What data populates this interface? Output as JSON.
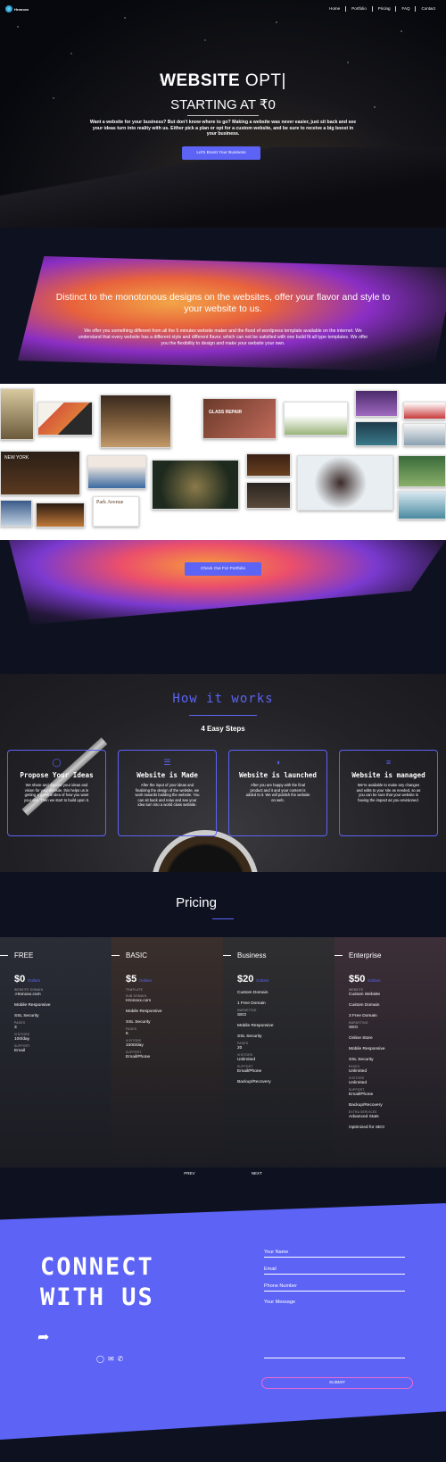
{
  "nav": {
    "logo_text": "Hronoxx",
    "items": [
      "Home",
      "Portfolio",
      "Pricing",
      "FAQ",
      "Contact"
    ]
  },
  "hero": {
    "title_bold": "WEBSITE",
    "title_light": "OPT|",
    "subtitle": "STARTING AT ₹0",
    "paragraph": "Want a website for your business? But don't know where to go? Making a website was never easier, just sit back and see your ideas turn into reality with us. Either pick a plan or opt for a custom website, and be sure to receive a big boost in your business.",
    "button": "Let's Boost Your Business"
  },
  "design": {
    "title": "Distinct to the monotonous designs on the websites, offer your flavor and style to your website to us.",
    "paragraph": "We offer you something different from all the 5 minutes website maker and the flood of wordpress template available on the internet. We understand that every website has a different style and different flavor, which can not be satisfied with one build fit all type templates. We offer you the flexibility to design and make your website your own.",
    "button": "Check Out For Portfolio",
    "thumb_texts": [
      "GLASS REPAIR",
      "NEW YORK",
      "Park Avenue",
      "Photo Gallery",
      "Make Yourself Beautiful"
    ]
  },
  "how": {
    "title": "How it works",
    "subtitle": "4 Easy Steps",
    "steps": [
      {
        "icon": "lightbulb-icon",
        "title": "Propose Your Ideas",
        "text": "We share and discuss your ideas and vision for your website, this helps us in getting a general idea of how you want your site. Then we start to build upon it."
      },
      {
        "icon": "layers-icon",
        "title": "Website is Made",
        "text": "After the input of your ideas and finalizing the design of the website, we work towards building the website. You can sit back and relax and see your idea turn into a world class website."
      },
      {
        "icon": "globe-icon",
        "title": "Website is launched",
        "text": "After you are happy with the final product and it and your content is added to it. We will publish the website on web."
      },
      {
        "icon": "list-check-icon",
        "title": "Website is managed",
        "text": "We're available to make any changes and edits to your site as needed, so as you can be sure that your website is having the impact as you envisioned."
      }
    ]
  },
  "pricing": {
    "title": "Pricing",
    "plans": [
      {
        "name": "FREE",
        "price": "$0",
        "period": "Dollars",
        "bg": "#2a2d36",
        "features": [
          {
            "l": "WEBSITE DOMAIN",
            "v": ".Hronoxx.com"
          },
          {
            "l": "",
            "v": "Mobile Responsive"
          },
          {
            "l": "",
            "v": "SSL Security"
          },
          {
            "l": "PAGES",
            "v": "3"
          },
          {
            "l": "VISITORS",
            "v": "100/day"
          },
          {
            "l": "SUPPORT",
            "v": "Email"
          }
        ]
      },
      {
        "name": "BASIC",
        "price": "$5",
        "period": "Dollars",
        "bg": "#3a2f2c",
        "features": [
          {
            "l": "TEMPLATE",
            "v": ""
          },
          {
            "l": "SUB DOMAIN",
            "v": "Hronoxx.com"
          },
          {
            "l": "",
            "v": "Mobile Responsive"
          },
          {
            "l": "",
            "v": "SSL Security"
          },
          {
            "l": "PAGES",
            "v": "6"
          },
          {
            "l": "VISITORS",
            "v": "1000/day"
          },
          {
            "l": "SUPPORT",
            "v": "Email/Phone"
          }
        ]
      },
      {
        "name": "Business",
        "price": "$20",
        "period": "Dollars",
        "bg": "#2f2f31",
        "features": [
          {
            "l": "",
            "v": "Custom Domain"
          },
          {
            "l": "",
            "v": "1 Free Domain"
          },
          {
            "l": "MARKETING",
            "v": "SEO"
          },
          {
            "l": "",
            "v": "Mobile Responsive"
          },
          {
            "l": "",
            "v": "SSL Security"
          },
          {
            "l": "PAGES",
            "v": "20"
          },
          {
            "l": "VISITORS",
            "v": "Unlimited"
          },
          {
            "l": "SUPPORT",
            "v": "Email/Phone"
          },
          {
            "l": "",
            "v": "Backup/Recovery"
          }
        ]
      },
      {
        "name": "Enterprise",
        "price": "$50",
        "period": "Dollars",
        "bg": "#3d2f38",
        "features": [
          {
            "l": "WEBSITE",
            "v": "Custom Website"
          },
          {
            "l": "",
            "v": "Custom Domain"
          },
          {
            "l": "",
            "v": "3 Free Domain"
          },
          {
            "l": "MARKETING",
            "v": "SEO"
          },
          {
            "l": "",
            "v": "Online Store"
          },
          {
            "l": "",
            "v": "Mobile Responsive"
          },
          {
            "l": "",
            "v": "SSL Security"
          },
          {
            "l": "PAGES",
            "v": "Unlimited"
          },
          {
            "l": "VISITORS",
            "v": "Unlimited"
          },
          {
            "l": "SUPPORT",
            "v": "Email/Phone"
          },
          {
            "l": "",
            "v": "Backup/Recovery"
          },
          {
            "l": "EXTRA SERVICES",
            "v": "Advanced Stats"
          },
          {
            "l": "",
            "v": "Optimized for SEO"
          }
        ]
      }
    ],
    "prev": "PREV",
    "next": "NEXT"
  },
  "contact": {
    "title_line1": "CONNECT",
    "title_line2": "WITH US",
    "fields": [
      "Your Name",
      "Email",
      "Phone Number"
    ],
    "message": "Your Message",
    "submit": "SUBMIT",
    "socials": [
      "instagram-icon",
      "mail-icon",
      "whatsapp-icon"
    ]
  }
}
